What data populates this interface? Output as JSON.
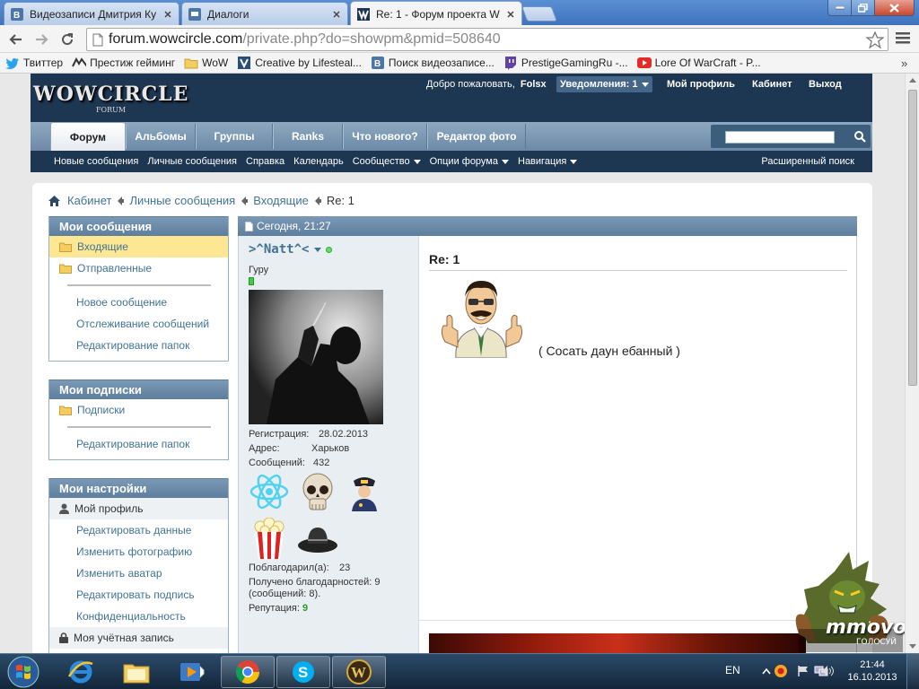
{
  "browser": {
    "tabs": [
      {
        "title": "Видеозаписи Дмитрия Ку",
        "icon": "vk-icon"
      },
      {
        "title": "Диалоги",
        "icon": "vk-message-icon"
      },
      {
        "title": "Re: 1 - Форум проекта W",
        "icon": "wowcircle-icon",
        "active": true
      }
    ],
    "url_host": "forum.wowcircle.com",
    "url_path": "/private.php?do=showpm&pmid=508640",
    "bookmarks": [
      {
        "label": "Твиттер",
        "icon": "twitter-icon"
      },
      {
        "label": "Престиж гейминг",
        "icon": "prestige-icon"
      },
      {
        "label": "WoW",
        "icon": "folder-icon"
      },
      {
        "label": "Creative by Lifesteal...",
        "icon": "v-icon"
      },
      {
        "label": "Поиск видеозаписе...",
        "icon": "vk-icon"
      },
      {
        "label": "PrestigeGamingRu -...",
        "icon": "twitch-icon"
      },
      {
        "label": "Lore Of WarCraft - P...",
        "icon": "youtube-icon"
      }
    ],
    "bookmarks_more": "»"
  },
  "forum": {
    "logo": "WOWCIRCLE",
    "logo_sub": "FORUM",
    "welcome_text": "Добро пожаловать,",
    "username": "Folsx",
    "notifications": "Уведомления: 1",
    "links": [
      "Мой профиль",
      "Кабинет",
      "Выход"
    ],
    "nav_tabs": [
      "Форум",
      "Альбомы",
      "Группы",
      "Ranks",
      "Что нового?",
      "Редактор фото"
    ],
    "subnav": [
      {
        "label": "Новые сообщения",
        "dropdown": false
      },
      {
        "label": "Личные сообщения",
        "dropdown": false
      },
      {
        "label": "Справка",
        "dropdown": false
      },
      {
        "label": "Календарь",
        "dropdown": false
      },
      {
        "label": "Сообщество",
        "dropdown": true
      },
      {
        "label": "Опции форума",
        "dropdown": true
      },
      {
        "label": "Навигация",
        "dropdown": true
      }
    ],
    "advanced_search": "Расширенный поиск"
  },
  "breadcrumb": [
    "Кабинет",
    "Личные сообщения",
    "Входящие",
    "Re: 1"
  ],
  "sidebar": {
    "messages": {
      "title": "Мои сообщения",
      "folders": [
        "Входящие",
        "Отправленные"
      ],
      "links": [
        "Новое сообщение",
        "Отслеживание сообщений",
        "Редактирование папок"
      ]
    },
    "subscriptions": {
      "title": "Мои подписки",
      "folders": [
        "Подписки"
      ],
      "links": [
        "Редактирование папок"
      ]
    },
    "settings": {
      "title": "Мои настройки",
      "profile_header": "Мой профиль",
      "links": [
        "Редактировать данные",
        "Изменить фотографию",
        "Изменить аватар",
        "Редактировать подпись",
        "Конфиденциальность"
      ],
      "account_header": "Моя учётная запись"
    }
  },
  "post": {
    "date": "Сегодня, 21:27",
    "author": ">^Natt^<",
    "author_title": "Гуру",
    "reg_label": "Регистрация:",
    "reg_value": "28.02.2013",
    "addr_label": "Адрес:",
    "addr_value": "Харьков",
    "posts_label": "Сообщений:",
    "posts_value": "432",
    "thanked_label": "Поблагодарил(а):",
    "thanked_value": "23",
    "thanks_received": "Получено благодарностей: 9",
    "thanks_received_posts": "(сообщений: 8).",
    "rep_label": "Репутация:",
    "rep_value": "9",
    "title": "Re: 1",
    "text": "( Сосать даун ебанный )"
  },
  "widget": {
    "brand": "mmovote",
    "sub": "ГОЛОСУЙ"
  },
  "taskbar": {
    "language": "EN",
    "time": "21:44",
    "date": "16.10.2013"
  }
}
